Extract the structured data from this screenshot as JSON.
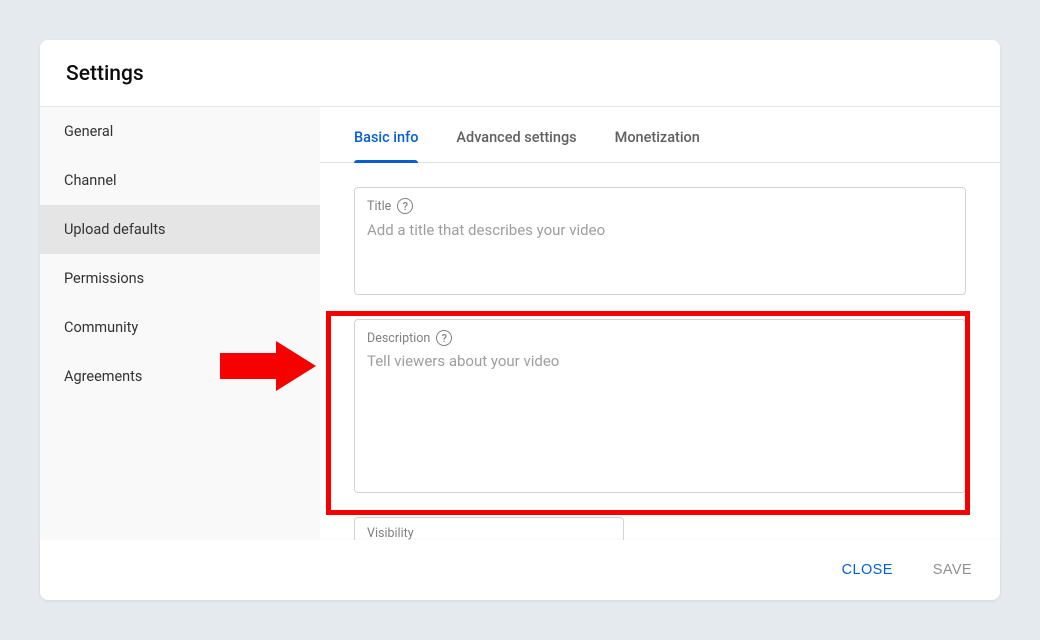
{
  "header": {
    "title": "Settings"
  },
  "sidebar": {
    "items": [
      {
        "label": "General",
        "selected": false
      },
      {
        "label": "Channel",
        "selected": false
      },
      {
        "label": "Upload defaults",
        "selected": true
      },
      {
        "label": "Permissions",
        "selected": false
      },
      {
        "label": "Community",
        "selected": false
      },
      {
        "label": "Agreements",
        "selected": false
      }
    ]
  },
  "tabs": [
    {
      "label": "Basic info",
      "active": true
    },
    {
      "label": "Advanced settings",
      "active": false
    },
    {
      "label": "Monetization",
      "active": false
    }
  ],
  "fields": {
    "title": {
      "label": "Title",
      "placeholder": "Add a title that describes your video",
      "value": ""
    },
    "description": {
      "label": "Description",
      "placeholder": "Tell viewers about your video",
      "value": ""
    },
    "visibility": {
      "label": "Visibility"
    }
  },
  "footer": {
    "close": "CLOSE",
    "save": "SAVE"
  },
  "annotation": {
    "target": "description-field"
  }
}
